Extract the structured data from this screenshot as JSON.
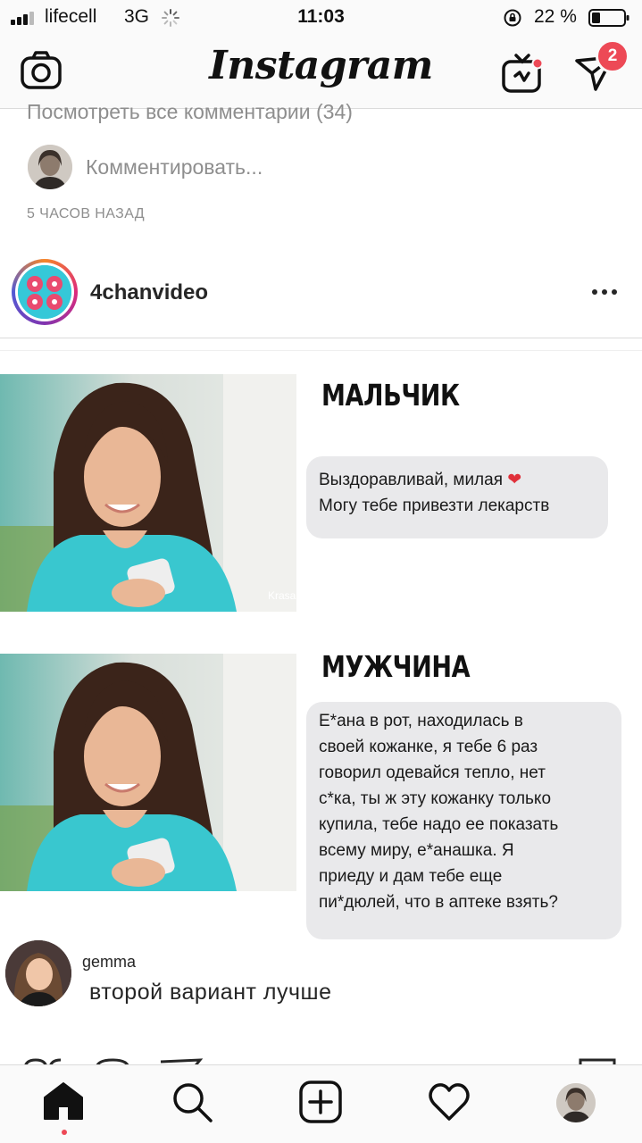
{
  "status_bar": {
    "carrier": "lifecell",
    "network": "3G",
    "time": "11:03",
    "battery_percent": "22 %"
  },
  "header": {
    "logo": "Instagram",
    "direct_badge_count": "2",
    "icons": [
      "camera-icon",
      "igtv-icon",
      "direct-icon"
    ]
  },
  "previous_post": {
    "view_all_comments": "Посмотреть все комментарии (34)",
    "comment_placeholder": "Комментировать...",
    "timestamp": "5 ЧАСОВ НАЗАД"
  },
  "post": {
    "username": "4chanvideo",
    "image": {
      "section_1_title": "МАЛЬЧИК",
      "section_1_message": "Выздоравливай, милая ❤️ Могу тебе привезти лекарств",
      "section_1_line_1": "Выздоравливай, милая",
      "section_1_line_2": "Могу тебе привезти лекарств",
      "section_2_title": "МУЖЧИНА",
      "section_2_lines": [
        "Е*ана в рот, находилась в",
        "своей кожанке, я тебе 6 раз",
        "говорил одевайся тепло, нет",
        "с*ка, ты ж эту кожанку только",
        "купила, тебе надо ее показать",
        "всему миру, е*анашка. Я",
        "приеду и дам тебе еще",
        "пи*дюлей, что в аптеке взять?"
      ],
      "watermark": "Krasa"
    },
    "featured_comment": {
      "username": "gemma",
      "text": "второй вариант лучше"
    }
  },
  "tab_bar": {
    "tabs": [
      "home",
      "search",
      "new-post",
      "activity",
      "profile"
    ],
    "active": "home"
  },
  "colors": {
    "accent_red": "#ed4956",
    "bubble_gray": "#e9e9eb",
    "muted_text": "#8e8e8e"
  }
}
